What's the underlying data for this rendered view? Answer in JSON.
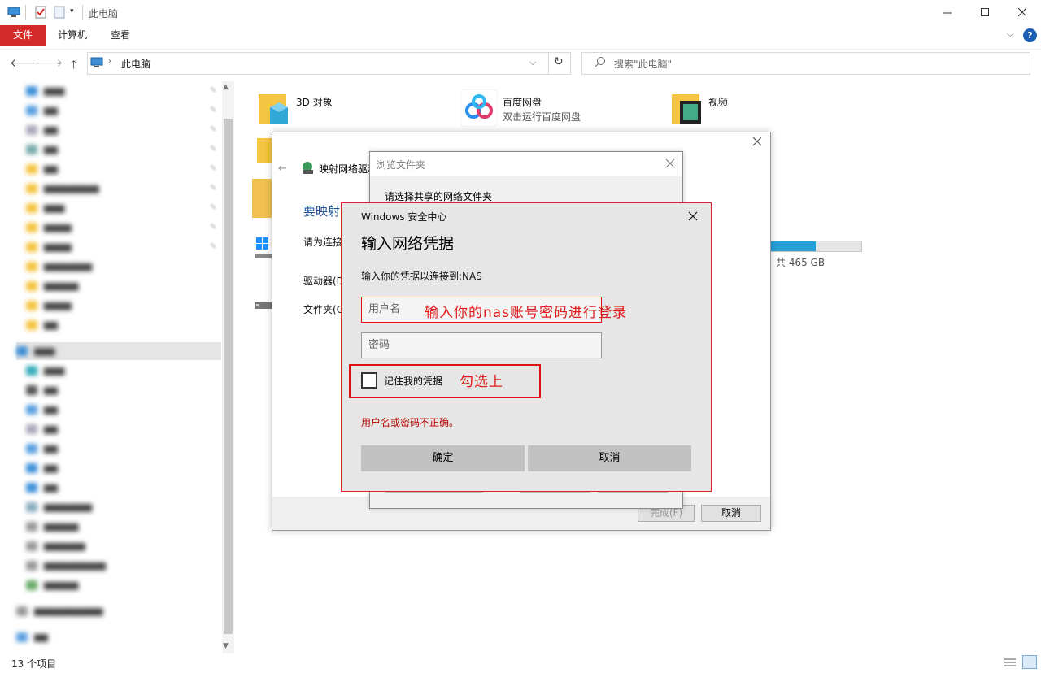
{
  "window": {
    "title": "此电脑",
    "tabs": [
      "文件",
      "计算机",
      "查看"
    ]
  },
  "address": {
    "path": "此电脑",
    "search_placeholder": "搜索\"此电脑\""
  },
  "content": {
    "items": [
      {
        "label": "3D 对象",
        "icon": "3d-objects-folder-icon"
      },
      {
        "label": "百度网盘",
        "sublabel": "双击运行百度网盘",
        "icon": "baidu-netdisk-icon"
      },
      {
        "label": "视频",
        "icon": "videos-folder-icon"
      }
    ],
    "drive": {
      "size_text": "共 465 GB",
      "used_fraction": 0.5
    }
  },
  "statusbar": {
    "count": "13 个项目"
  },
  "wizard": {
    "title": "映射网络驱动",
    "heading": "要映射",
    "line1": "请为连接",
    "drive_label": "驱动器(D",
    "folder_label": "文件夹(O",
    "finish_button": "完成(F)",
    "cancel_button": "取消"
  },
  "browse": {
    "title": "浏览文件夹",
    "prompt": "请选择共享的网络文件夹"
  },
  "credential": {
    "app_title": "Windows 安全中心",
    "heading": "输入网络凭据",
    "description": "输入你的凭据以连接到:NAS",
    "username_placeholder": "用户名",
    "password_placeholder": "密码",
    "remember_label": "记住我的凭据",
    "error": "用户名或密码不正确。",
    "ok_button": "确定",
    "cancel_button": "取消"
  },
  "annotations": {
    "username_hint": "输入你的nas账号密码进行登录",
    "remember_hint": "勾选上"
  },
  "colors": {
    "accent_red": "#d42a2a",
    "link_blue": "#1e4f96",
    "error_red": "#b00000",
    "annotation_red": "#e01a1a",
    "drive_bar": "#26a0da"
  }
}
